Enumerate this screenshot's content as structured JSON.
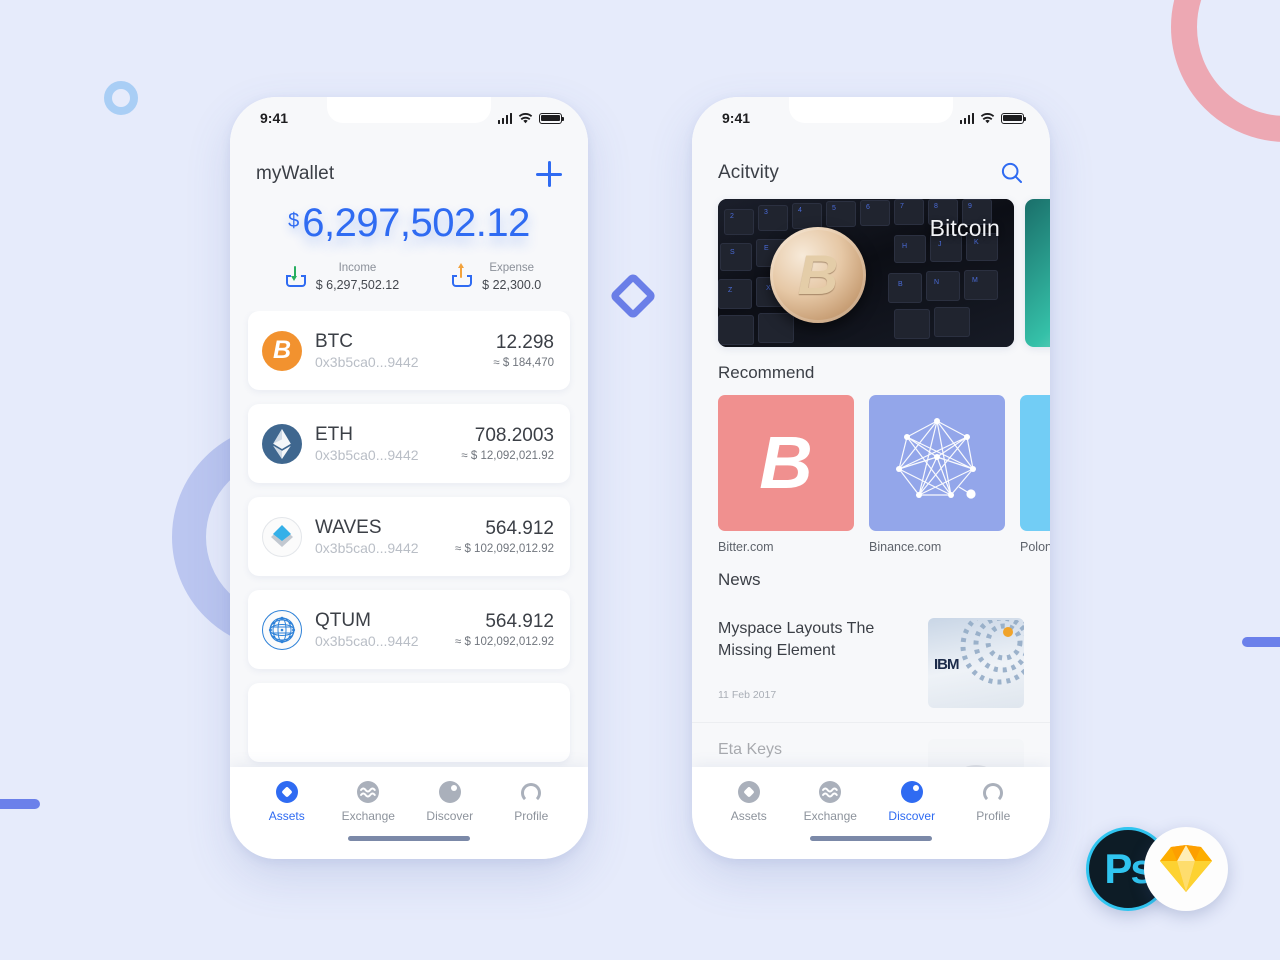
{
  "background": {
    "color": "#e6ebfb",
    "decorations": [
      {
        "name": "small-blue-ring",
        "color": "#a9cef5"
      },
      {
        "name": "large-periwinkle-ring",
        "color": "#b8c4ef"
      },
      {
        "name": "pink-ring-arc",
        "color": "#eda8b3"
      },
      {
        "name": "blue-diamond-outline",
        "color": "#6b7fe8"
      },
      {
        "name": "blue-bar-left",
        "color": "#6b80ea"
      },
      {
        "name": "blue-bar-right",
        "color": "#6b80ea"
      }
    ]
  },
  "accent": "#2f6bf2",
  "wallet_screen": {
    "status_bar": {
      "time": "9:41"
    },
    "title": "myWallet",
    "add_button": "+",
    "balance": {
      "currency_symbol": "$",
      "amount": "6,297,502.12"
    },
    "income": {
      "label": "Income",
      "value": "$ 6,297,502.12"
    },
    "expense": {
      "label": "Expense",
      "value": "$ 22,300.0"
    },
    "assets": [
      {
        "symbol": "BTC",
        "address": "0x3b5ca0...9442",
        "amount": "12.298",
        "usd": "≈ $ 184,470",
        "icon": "bitcoin-icon",
        "color": "#f2922f"
      },
      {
        "symbol": "ETH",
        "address": "0x3b5ca0...9442",
        "amount": "708.2003",
        "usd": "≈ $ 12,092,021.92",
        "icon": "ethereum-icon",
        "color": "#3f678f"
      },
      {
        "symbol": "WAVES",
        "address": "0x3b5ca0...9442",
        "amount": "564.912",
        "usd": "≈ $ 102,092,012.92",
        "icon": "waves-icon",
        "color": "#35b0e8"
      },
      {
        "symbol": "QTUM",
        "address": "0x3b5ca0...9442",
        "amount": "564.912",
        "usd": "≈ $ 102,092,012.92",
        "icon": "qtum-icon",
        "color": "#2f82d8"
      }
    ],
    "tabs": [
      {
        "label": "Assets",
        "icon": "assets-icon",
        "active": true
      },
      {
        "label": "Exchange",
        "icon": "exchange-icon",
        "active": false
      },
      {
        "label": "Discover",
        "icon": "discover-icon",
        "active": false
      },
      {
        "label": "Profile",
        "icon": "profile-icon",
        "active": false
      }
    ]
  },
  "discover_screen": {
    "status_bar": {
      "time": "9:41"
    },
    "title": "Acitvity",
    "search_icon": "search-icon",
    "banner": {
      "caption": "Bitcoin"
    },
    "recommend": {
      "heading": "Recommend",
      "items": [
        {
          "name": "Bitter.com",
          "icon": "bitcoin-logo",
          "color": "#f0908f"
        },
        {
          "name": "Binance.com",
          "icon": "binance-logo",
          "color": "#93a6ea"
        },
        {
          "name": "Polon",
          "icon": "poloniex-logo",
          "color": "#72cdf5"
        }
      ]
    },
    "news": {
      "heading": "News",
      "items": [
        {
          "title": "Myspace Layouts The Missing Element",
          "date": "11 Feb 2017",
          "thumb": "ibm-servers-image"
        },
        {
          "title": "Eta Keys",
          "date": "",
          "thumb": "portrait-image"
        }
      ]
    },
    "tabs": [
      {
        "label": "Assets",
        "icon": "assets-icon",
        "active": false
      },
      {
        "label": "Exchange",
        "icon": "exchange-icon",
        "active": false
      },
      {
        "label": "Discover",
        "icon": "discover-icon",
        "active": true
      },
      {
        "label": "Profile",
        "icon": "profile-icon",
        "active": false
      }
    ]
  },
  "badges": [
    {
      "name": "photoshop-badge",
      "label": "Ps",
      "color": "#30c5f0"
    },
    {
      "name": "sketch-badge",
      "label": "",
      "color": "#f7a823"
    }
  ]
}
